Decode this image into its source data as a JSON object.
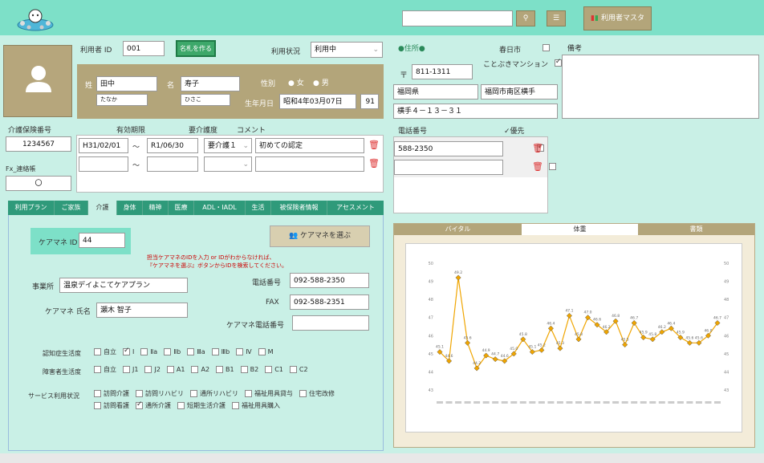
{
  "header": {
    "search_value": "",
    "master_button": "利用者マスタ"
  },
  "user": {
    "id_label": "利用者 ID",
    "id": "001",
    "nameplate_button": "名札を作る",
    "status_label": "利用状況",
    "status": "利用中",
    "surname_label": "姓",
    "surname": "田中",
    "surname_kana": "たなか",
    "given_label": "名",
    "given": "寿子",
    "given_kana": "ひさこ",
    "gender_label": "性別",
    "gender_female": "女",
    "gender_male": "男",
    "birth_label": "生年月日",
    "birth": "昭和4年03月07日",
    "age": "91"
  },
  "address": {
    "address_label": "●住所●",
    "kasuga_label": "春日市",
    "kotobuki_label": "ことぶきマンション",
    "postal_mark": "〒",
    "postal": "811-1311",
    "prefecture": "福岡県",
    "city": "福岡市南区横手",
    "street": "横手４－１３－３１",
    "notes_label": "備考"
  },
  "insurance": {
    "number_label": "介護保険番号",
    "number": "1234567",
    "period_label": "有効期限",
    "level_label": "要介護度",
    "comment_label": "コメント",
    "rows": [
      {
        "from": "H31/02/01",
        "tilde": "～",
        "to": "R1/06/30",
        "level": "要介護１",
        "comment": "初めての認定"
      },
      {
        "from": "",
        "tilde": "～",
        "to": "",
        "level": "",
        "comment": ""
      }
    ],
    "fax_label": "Fx_連絡帳",
    "fax_value": "〇"
  },
  "phone": {
    "label": "電話番号",
    "priority_label": "✓優先",
    "numbers": [
      "588-2350",
      ""
    ]
  },
  "tabs": [
    "利用プラン",
    "ご家族",
    "介護",
    "身体",
    "精神",
    "医療",
    "ADL・IADL",
    "生活",
    "被保険者情報",
    "アセスメント"
  ],
  "care": {
    "cm_id_label": "ケアマネ ID",
    "cm_id": "44",
    "select_button": "ケアマネを選ぶ",
    "note1": "担当ケアマネのIDを入力 or IDがわからなければ、",
    "note2": "『ケアマネを選ぶ』ボタンからIDを検索してください。",
    "office_label": "事業所",
    "office": "温泉デイよこてケアプラン",
    "tel_label": "電話番号",
    "tel": "092-588-2350",
    "fax_label": "FAX",
    "fax": "092-588-2351",
    "cm_name_label": "ケアマネ 氏名",
    "cm_name": "瀬木 智子",
    "cm_tel_label": "ケアマネ電話番号",
    "cm_tel": "",
    "dementia_label": "認知症生活度",
    "dementia_opts": [
      "自立",
      "I",
      "Ⅱa",
      "Ⅱb",
      "Ⅲa",
      "Ⅲb",
      "Ⅳ",
      "M"
    ],
    "disability_label": "障害者生活度",
    "disability_opts": [
      "自立",
      "J1",
      "J2",
      "A1",
      "A2",
      "B1",
      "B2",
      "C1",
      "C2"
    ],
    "service_label": "サービス利用状況",
    "service_row1": [
      "訪問介護",
      "訪問リハビリ",
      "通所リハビリ",
      "福祉用具貸与",
      "住宅改修"
    ],
    "service_row2": [
      "訪問看護",
      "通所介護",
      "短期生活介護",
      "福祉用具購入"
    ]
  },
  "chart_tabs": [
    "バイタル",
    "体重",
    "書類"
  ],
  "chart_data": {
    "type": "line",
    "title": "",
    "ylim": [
      43,
      50
    ],
    "yticks": [
      43,
      44,
      45,
      46,
      47,
      48,
      49,
      50
    ],
    "values": [
      45.1,
      44.6,
      49.2,
      45.6,
      44.2,
      44.9,
      44.7,
      44.6,
      45.0,
      45.8,
      45.1,
      45.2,
      46.4,
      45.3,
      47.1,
      45.8,
      47.0,
      46.6,
      46.2,
      46.8,
      45.5,
      46.7,
      45.9,
      45.8,
      46.2,
      46.4,
      45.9,
      45.6,
      45.6,
      46.0,
      46.7
    ],
    "labels": [
      "45.1",
      "44.6",
      "49.2",
      "45.6",
      "44.2",
      "44.9",
      "44.7",
      "44.6",
      "45.0",
      "45.8",
      "45.1",
      "45.2",
      "46.4",
      "45.3",
      "47.1",
      "45.8",
      "47.0",
      "46.6",
      "46.2",
      "46.8",
      "45.5",
      "46.7",
      "45.9",
      "45.8",
      "46.2",
      "46.4",
      "45.9",
      "45.6",
      "45.6",
      "46.0",
      "46.7"
    ],
    "color": "#f0a500",
    "grid": false
  }
}
